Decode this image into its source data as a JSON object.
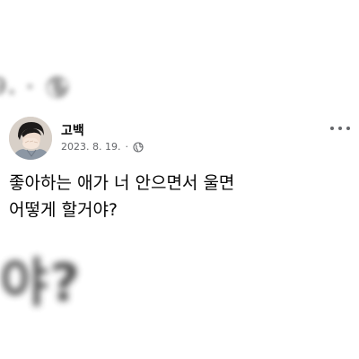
{
  "background": {
    "top_fragment": "9.",
    "top_dot": "•",
    "bottom_fragment": "야?"
  },
  "post": {
    "author": "고백",
    "date": "2023. 8. 19.",
    "separator": "·",
    "privacy_icon": "globe-icon",
    "more_icon": "more-options-icon",
    "text": "좋아하는 애가 너 안으면서 울면\n어떻게 할거야?"
  },
  "colors": {
    "text_primary": "#050505",
    "text_secondary": "#65676b",
    "background": "#ffffff"
  }
}
